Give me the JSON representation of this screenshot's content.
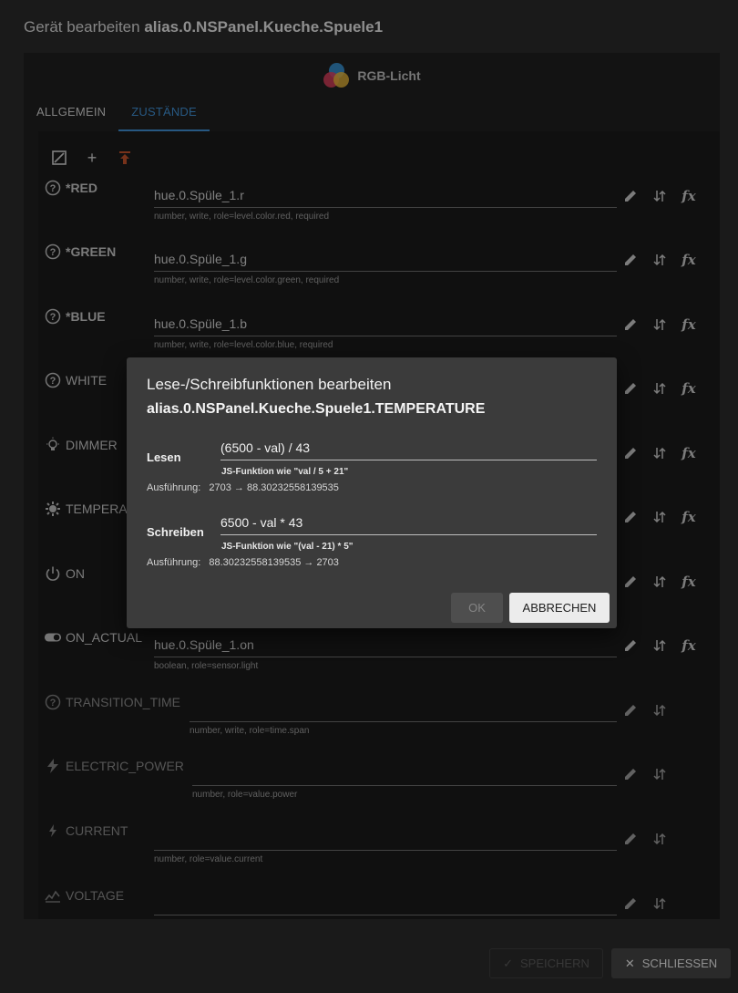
{
  "dialog": {
    "title_prefix": "Gerät bearbeiten",
    "title_id": "alias.0.NSPanel.Kueche.Spuele1",
    "type_name": "RGB-Licht"
  },
  "tabs": [
    {
      "label": "ALLGEMEIN"
    },
    {
      "label": "ZUSTÄNDE"
    }
  ],
  "active_tab": "ZUSTÄNDE",
  "states": [
    {
      "name": "*RED",
      "value": "hue.0.Spüle_1.r",
      "hint": "number, write, role=level.color.red, required",
      "icon": "help-icon"
    },
    {
      "name": "*GREEN",
      "value": "hue.0.Spüle_1.g",
      "hint": "number, write, role=level.color.green, required",
      "icon": "help-icon"
    },
    {
      "name": "*BLUE",
      "value": "hue.0.Spüle_1.b",
      "hint": "number, write, role=level.color.blue, required",
      "icon": "help-icon"
    },
    {
      "name": "WHITE",
      "value": "",
      "hint": "",
      "icon": "help-icon"
    },
    {
      "name": "DIMMER",
      "value": "",
      "hint": "",
      "icon": "lightbulb-icon"
    },
    {
      "name": "TEMPERA",
      "value": "",
      "hint": "",
      "icon": "sun-icon"
    },
    {
      "name": "ON",
      "value": "",
      "hint": "",
      "icon": "power-icon"
    },
    {
      "name": "ON_ACTUAL",
      "value": "hue.0.Spüle_1.on",
      "hint": "boolean, role=sensor.light",
      "icon": "toggle-icon"
    },
    {
      "name": "TRANSITION_TIME",
      "value": "",
      "hint": "number, write, role=time.span",
      "icon": "help-icon"
    },
    {
      "name": "ELECTRIC_POWER",
      "value": "",
      "hint": "number, role=value.power",
      "icon": "bolt-icon"
    },
    {
      "name": "CURRENT",
      "value": "",
      "hint": "number, role=value.current",
      "icon": "bolt-small-icon"
    },
    {
      "name": "VOLTAGE",
      "value": "",
      "hint": "",
      "icon": "voltage-icon"
    }
  ],
  "footer": {
    "save_label": "SPEICHERN",
    "close_label": "SCHLIESSEN"
  },
  "modal": {
    "title": "Lese-/Schreibfunktionen bearbeiten",
    "subtitle": "alias.0.NSPanel.Kueche.Spuele1.TEMPERATURE",
    "read": {
      "label": "Lesen",
      "value": "(6500 - val) / 43",
      "hint": "JS-Funktion wie \"val / 5 + 21\"",
      "exec_label": "Ausführung:",
      "exec_value": "2703 → 88.30232558139535"
    },
    "write": {
      "label": "Schreiben",
      "value": "6500 - val * 43",
      "hint": "JS-Funktion wie \"(val - 21) * 5\"",
      "exec_label": "Ausführung:",
      "exec_value": "88.30232558139535 → 2703"
    },
    "ok_label": "OK",
    "cancel_label": "ABBRECHEN"
  },
  "colors": {
    "accent": "#3f8fd2",
    "logo_red": "#e0405f",
    "logo_yellow": "#e8b53a",
    "logo_blue": "#3a9be0"
  }
}
